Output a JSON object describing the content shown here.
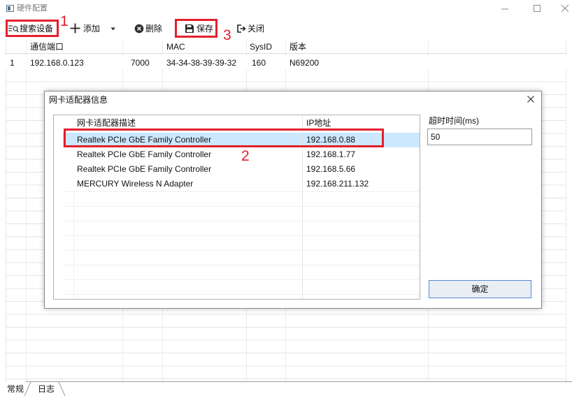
{
  "window": {
    "title": "硬件配置",
    "app_icon": "app-icon",
    "controls": [
      "minimize-icon",
      "maximize-icon",
      "close-icon"
    ]
  },
  "toolbar": {
    "search": {
      "label": "搜索设备",
      "icon": "search-list-icon"
    },
    "add": {
      "label": "添加",
      "icon": "plus-icon"
    },
    "add_menu": {
      "icon": "chevron-down-icon"
    },
    "delete": {
      "label": "删除",
      "icon": "delete-circle-icon"
    },
    "save": {
      "label": "保存",
      "icon": "save-icon"
    },
    "close": {
      "label": "关闭",
      "icon": "exit-icon"
    }
  },
  "annotations": {
    "step1": "1",
    "step2": "2",
    "step3": "3"
  },
  "device_table": {
    "columns": [
      "",
      "通信端口",
      "",
      "MAC",
      "SysID",
      "版本"
    ],
    "rows": [
      [
        "1",
        "192.168.0.123",
        "7000",
        "34-34-38-39-39-32",
        "160",
        "N69200"
      ]
    ]
  },
  "adapter_dialog": {
    "title": "网卡适配器信息",
    "close_icon": "close-icon",
    "columns": [
      "网卡适配器描述",
      "IP地址"
    ],
    "adapters": [
      {
        "description": "Realtek PCIe GbE Family Controller",
        "ip": "192.168.0.88",
        "selected": true
      },
      {
        "description": "Realtek PCIe GbE Family Controller",
        "ip": "192.168.1.77",
        "selected": false
      },
      {
        "description": "Realtek PCIe GbE Family Controller",
        "ip": "192.168.5.66",
        "selected": false
      },
      {
        "description": "MERCURY Wireless N Adapter",
        "ip": "192.168.211.132",
        "selected": false
      }
    ],
    "timeout": {
      "label": "超时时间(ms)",
      "value": "50"
    },
    "ok_label": "确定"
  },
  "bottom_tabs": [
    {
      "label": "常规",
      "active": true
    },
    {
      "label": "日志",
      "active": false
    }
  ],
  "colors": {
    "annotation_red": "#e3202c",
    "selected_row": "#cce8ff",
    "ok_button_border": "#4f8bd6",
    "ok_button_bg": "#e9eef4"
  }
}
